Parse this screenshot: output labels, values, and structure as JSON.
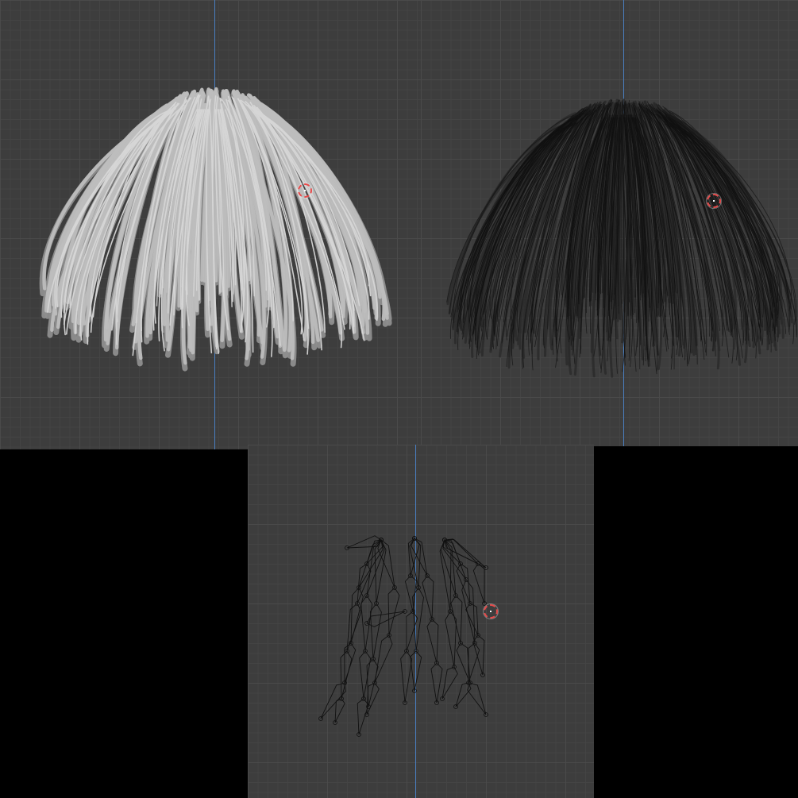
{
  "viewports": [
    {
      "id": "solid",
      "shading": "solid"
    },
    {
      "id": "wireframe",
      "shading": "wireframe"
    },
    {
      "id": "armature",
      "shading": "bones"
    }
  ],
  "colors": {
    "grid_bg": "#3d3d3d",
    "axis": "#4a7fc1",
    "cursor": "#e84b4b",
    "solid_hair": "#bdbdbd",
    "wire_hair": "#1a1a1a",
    "bones": "#111111"
  },
  "icons": {
    "cursor": "3d-cursor-icon"
  }
}
